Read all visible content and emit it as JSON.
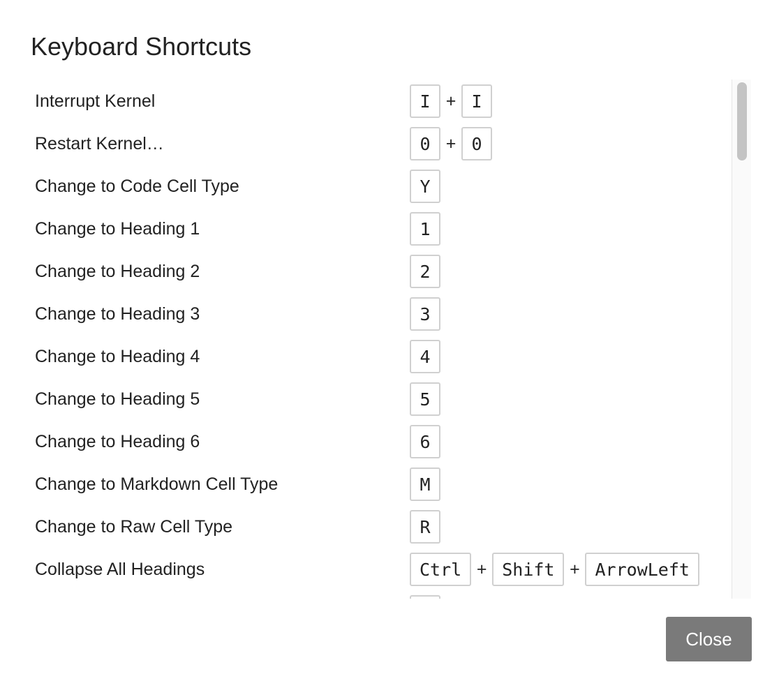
{
  "dialog": {
    "title": "Keyboard Shortcuts",
    "close_label": "Close"
  },
  "shortcuts": [
    {
      "label": "Interrupt Kernel",
      "keys": [
        "I",
        "I"
      ]
    },
    {
      "label": "Restart Kernel…",
      "keys": [
        "0",
        "0"
      ]
    },
    {
      "label": "Change to Code Cell Type",
      "keys": [
        "Y"
      ]
    },
    {
      "label": "Change to Heading 1",
      "keys": [
        "1"
      ]
    },
    {
      "label": "Change to Heading 2",
      "keys": [
        "2"
      ]
    },
    {
      "label": "Change to Heading 3",
      "keys": [
        "3"
      ]
    },
    {
      "label": "Change to Heading 4",
      "keys": [
        "4"
      ]
    },
    {
      "label": "Change to Heading 5",
      "keys": [
        "5"
      ]
    },
    {
      "label": "Change to Heading 6",
      "keys": [
        "6"
      ]
    },
    {
      "label": "Change to Markdown Cell Type",
      "keys": [
        "M"
      ]
    },
    {
      "label": "Change to Raw Cell Type",
      "keys": [
        "R"
      ]
    },
    {
      "label": "Collapse All Headings",
      "keys": [
        "Ctrl",
        "Shift",
        "ArrowLeft"
      ]
    },
    {
      "label": "",
      "keys": [
        ""
      ]
    }
  ],
  "key_separator": "+"
}
